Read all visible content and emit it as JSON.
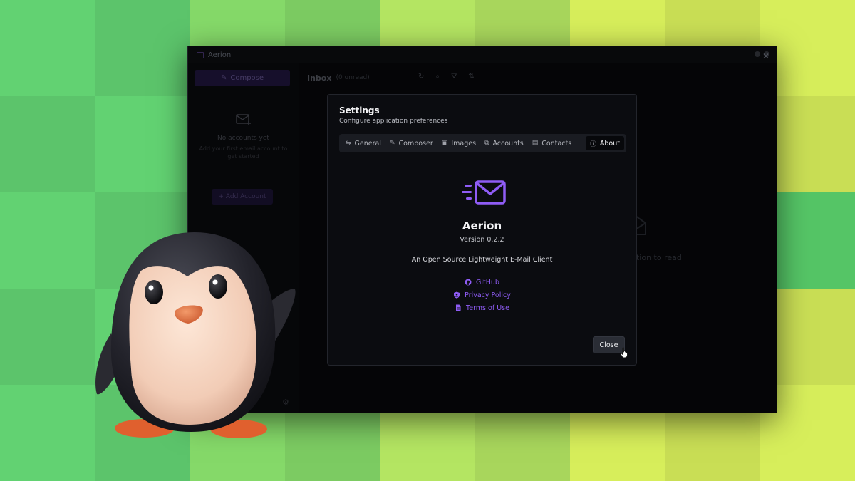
{
  "colors": {
    "accent": "#8f5cf5",
    "dialog_bg": "#0b0c10",
    "window_bg": "#08090c",
    "checker": [
      "#5cc46b",
      "#7ccb62",
      "#a8d65c",
      "#c9de55",
      "#4fb85f"
    ]
  },
  "window": {
    "title": "Aerion"
  },
  "sidebar": {
    "compose_label": "Compose",
    "empty_title": "No accounts yet",
    "empty_subtitle": "Add your first email account to get started",
    "add_account_label": "+ Add Account"
  },
  "inbox": {
    "title": "Inbox",
    "unread": "(0 unread)"
  },
  "reader": {
    "empty_text": "rsation to read"
  },
  "settings": {
    "title": "Settings",
    "subtitle": "Configure application preferences",
    "tabs": [
      {
        "label": "General",
        "icon": "sliders-icon"
      },
      {
        "label": "Composer",
        "icon": "pencil-icon"
      },
      {
        "label": "Images",
        "icon": "image-icon"
      },
      {
        "label": "Accounts",
        "icon": "accounts-icon"
      },
      {
        "label": "Contacts",
        "icon": "contact-card-icon"
      },
      {
        "label": "About",
        "icon": "info-icon",
        "active": true
      }
    ],
    "about": {
      "app_name": "Aerion",
      "version": "Version 0.2.2",
      "description": "An Open Source Lightweight E-Mail Client",
      "links": [
        {
          "label": "GitHub",
          "icon": "github-icon"
        },
        {
          "label": "Privacy Policy",
          "icon": "shield-user-icon"
        },
        {
          "label": "Terms of Use",
          "icon": "document-icon"
        }
      ]
    },
    "close_label": "Close"
  }
}
